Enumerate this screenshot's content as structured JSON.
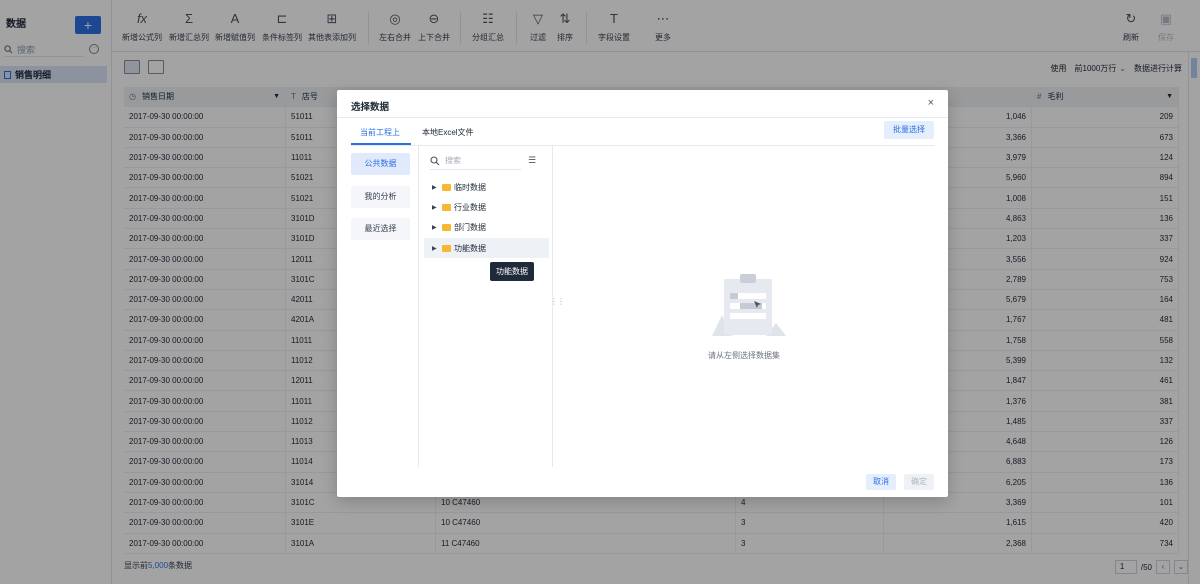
{
  "sidebar": {
    "title": "数据",
    "add_label": "+",
    "search_placeholder": "搜索",
    "items": [
      {
        "label": "销售明细"
      }
    ]
  },
  "toolbar": {
    "buttons": [
      {
        "label": "新增公式列",
        "icon": "fx"
      },
      {
        "label": "新增汇总列",
        "icon": "Σ"
      },
      {
        "label": "新增赋值列",
        "icon": "A"
      },
      {
        "label": "条件标签列",
        "icon": "⊏"
      },
      {
        "label": "其他表添加列",
        "icon": "⊞"
      },
      {
        "label": "左右合并",
        "icon": "◎"
      },
      {
        "label": "上下合并",
        "icon": "⊖"
      },
      {
        "label": "分组汇总",
        "icon": "☷"
      },
      {
        "label": "过滤",
        "icon": "▽"
      },
      {
        "label": "排序",
        "icon": "⇅"
      },
      {
        "label": "字段设置",
        "icon": "T"
      },
      {
        "label": "更多",
        "icon": "⋯"
      },
      {
        "label": "刷新",
        "icon": "↻"
      },
      {
        "label": "保存",
        "icon": "▣"
      }
    ]
  },
  "viewbar": {
    "use_label": "使用",
    "limit_value": "前1000万行",
    "calc_label": "数据进行计算"
  },
  "table": {
    "headers": [
      "销售日期",
      "店号",
      "",
      "",
      "",
      "毛利"
    ],
    "rows": [
      [
        "2017-09-30 00:00:00",
        "51011",
        "",
        "",
        "1,046",
        "209"
      ],
      [
        "2017-09-30 00:00:00",
        "51011",
        "",
        "",
        "3,366",
        "673"
      ],
      [
        "2017-09-30 00:00:00",
        "11011",
        "",
        "",
        "3,979",
        "124"
      ],
      [
        "2017-09-30 00:00:00",
        "51021",
        "",
        "",
        "5,960",
        "894"
      ],
      [
        "2017-09-30 00:00:00",
        "51021",
        "",
        "",
        "1,008",
        "151"
      ],
      [
        "2017-09-30 00:00:00",
        "3101D",
        "",
        "",
        "4,863",
        "136"
      ],
      [
        "2017-09-30 00:00:00",
        "3101D",
        "",
        "",
        "1,203",
        "337"
      ],
      [
        "2017-09-30 00:00:00",
        "12011",
        "",
        "",
        "3,556",
        "924"
      ],
      [
        "2017-09-30 00:00:00",
        "3101C",
        "",
        "",
        "2,789",
        "753"
      ],
      [
        "2017-09-30 00:00:00",
        "42011",
        "",
        "",
        "5,679",
        "164"
      ],
      [
        "2017-09-30 00:00:00",
        "4201A",
        "",
        "",
        "1,767",
        "481"
      ],
      [
        "2017-09-30 00:00:00",
        "11011",
        "",
        "",
        "1,758",
        "558"
      ],
      [
        "2017-09-30 00:00:00",
        "11012",
        "",
        "",
        "5,399",
        "132"
      ],
      [
        "2017-09-30 00:00:00",
        "12011",
        "",
        "",
        "1,847",
        "461"
      ],
      [
        "2017-09-30 00:00:00",
        "11011",
        "",
        "",
        "1,376",
        "381"
      ],
      [
        "2017-09-30 00:00:00",
        "11012",
        "",
        "",
        "1,485",
        "337"
      ],
      [
        "2017-09-30 00:00:00",
        "11013",
        "",
        "",
        "4,648",
        "126"
      ],
      [
        "2017-09-30 00:00:00",
        "11014",
        "",
        "",
        "6,883",
        "173"
      ],
      [
        "2017-09-30 00:00:00",
        "31014",
        "",
        "",
        "6,205",
        "136"
      ],
      [
        "2017-09-30 00:00:00",
        "3101C",
        "10 C47460",
        "4",
        "3,369",
        "101"
      ],
      [
        "2017-09-30 00:00:00",
        "3101E",
        "10 C47460",
        "3",
        "1,615",
        "420"
      ],
      [
        "2017-09-30 00:00:00",
        "3101A",
        "11 C47460",
        "3",
        "2,368",
        "734"
      ]
    ]
  },
  "footer": {
    "prefix": "显示前",
    "count": "5,000",
    "suffix": "条数据",
    "page": "1",
    "total_pages": "/50"
  },
  "modal": {
    "title": "选择数据",
    "close": "×",
    "tabs": [
      "当前工程上",
      "本地Excel文件"
    ],
    "batch_label": "批量选择",
    "left_items": [
      "公共数据",
      "我的分析",
      "最近选择"
    ],
    "search_placeholder": "搜索",
    "tree": [
      "临时数据",
      "行业数据",
      "部门数据",
      "功能数据"
    ],
    "tooltip": "功能数据",
    "empty_text": "请从左侧选择数据集",
    "cancel_label": "取消",
    "ok_label": "确定"
  },
  "colors": {
    "accent": "#2b6fe6",
    "folder": "#f7b733",
    "overlay": "rgba(0,0,0,0.36)"
  }
}
